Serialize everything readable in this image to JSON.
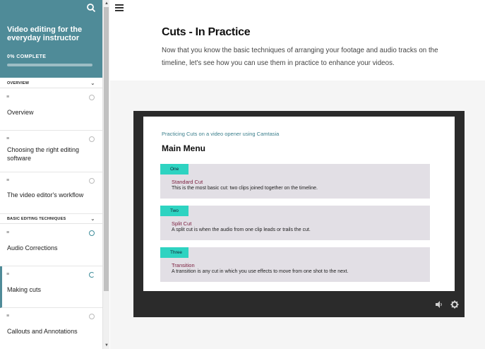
{
  "sidebar": {
    "course_title": "Video editing for the everyday instructor",
    "progress_label": "0% COMPLETE",
    "progress_percent": 0,
    "sections": [
      {
        "title": "OVERVIEW",
        "lessons": [
          {
            "label": "Overview",
            "status": "not-started"
          },
          {
            "label": "Choosing the right editing software",
            "status": "not-started"
          },
          {
            "label": "The video editor's workflow",
            "status": "not-started"
          }
        ]
      },
      {
        "title": "BASIC EDITING TECHNIQUES",
        "lessons": [
          {
            "label": "Audio Corrections",
            "status": "not-started"
          },
          {
            "label": "Making cuts",
            "status": "in-progress"
          },
          {
            "label": "Callouts and Annotations",
            "status": "not-started"
          }
        ]
      }
    ]
  },
  "main": {
    "title": "Cuts - In Practice",
    "intro": "Now that you know the basic techniques of arranging your footage and audio tracks on the timeline, let's see how you can use them in practice to enhance your videos."
  },
  "video": {
    "subtitle": "Practicing Cuts on a video opener using Camtasia",
    "menu_title": "Main Menu",
    "items": [
      {
        "tag": "One",
        "title": "Standard Cut",
        "desc": "This is the most basic cut: two clips joined together on the timeline."
      },
      {
        "tag": "Two",
        "title": "Split Cut",
        "desc": "A split cut is when the audio from one clip leads or trails the cut."
      },
      {
        "tag": "Three",
        "title": "Transition",
        "desc": "A transition is any cut in which you use effects to move from one shot to the next."
      }
    ]
  },
  "colors": {
    "sidebar_header": "#4f8b98",
    "tag_accent": "#2ed3c1",
    "card_bg": "#e2dfe5",
    "item_title": "#7a1c3c"
  },
  "icons": {
    "search": "search-icon",
    "hamburger": "hamburger-menu-icon",
    "chevron": "chevron-down-icon",
    "lesson": "lesson-text-icon",
    "volume": "volume-icon",
    "settings": "gear-icon"
  }
}
